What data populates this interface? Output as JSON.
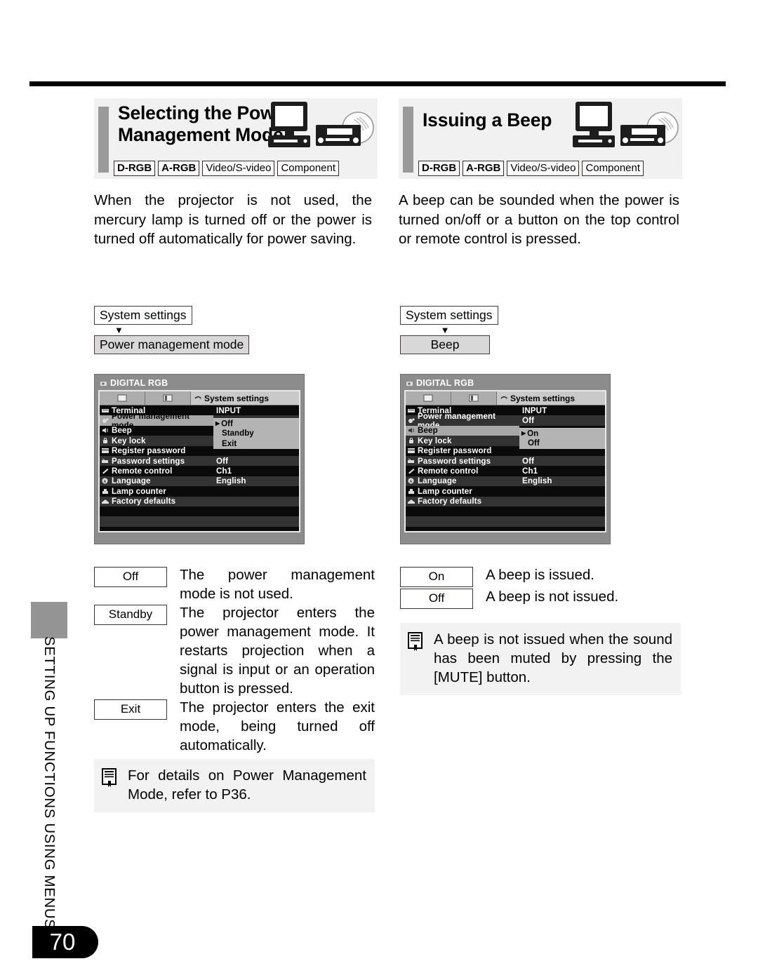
{
  "page": {
    "number": "70",
    "side_tab_label": "SETTING UP FUNCTIONS USING MENUS"
  },
  "sections": [
    {
      "title_line1": "Selecting the Power",
      "title_line2": "Management Mode",
      "badges": [
        "D-RGB",
        "A-RGB",
        "Video/S-video",
        "Component"
      ],
      "intro": "When the projector is not used, the mercury lamp is turned off or the power is turned off automatically for power saving.",
      "breadcrumb": {
        "parent": "System settings",
        "child": "Power management mode"
      },
      "osd": {
        "title": "DIGITAL RGB",
        "active_tab": "System settings",
        "rows": [
          {
            "label": "Terminal",
            "value": "INPUT",
            "icon": "terminal-icon"
          },
          {
            "label": "Power management mode",
            "value": "Off",
            "icon": "power-icon"
          },
          {
            "label": "Beep",
            "value": "",
            "icon": "beep-icon"
          },
          {
            "label": "Key lock",
            "value": "",
            "icon": "lock-icon"
          },
          {
            "label": "Register password",
            "value": "",
            "icon": "register-password-icon"
          },
          {
            "label": "Password settings",
            "value": "Off",
            "icon": "password-settings-icon"
          },
          {
            "label": "Remote control",
            "value": "Ch1",
            "icon": "remote-control-icon"
          },
          {
            "label": "Language",
            "value": "English",
            "icon": "language-icon"
          },
          {
            "label": "Lamp counter",
            "value": "",
            "icon": "lamp-counter-icon"
          },
          {
            "label": "Factory defaults",
            "value": "",
            "icon": "factory-defaults-icon"
          }
        ],
        "submenu": {
          "selected": "Off",
          "options": [
            "Off",
            "Standby",
            "Exit"
          ]
        }
      },
      "options": [
        {
          "key": "Off",
          "desc": "The power management mode is not used."
        },
        {
          "key": "Standby",
          "desc": "The projector enters the power management mode. It restarts projection when a signal is input or an operation button is pressed."
        },
        {
          "key": "Exit",
          "desc": "The projector enters the exit mode, being turned off automatically."
        }
      ],
      "note": "For details on Power Management Mode, refer to P36."
    },
    {
      "title_line1": "Issuing a Beep",
      "title_line2": "",
      "badges": [
        "D-RGB",
        "A-RGB",
        "Video/S-video",
        "Component"
      ],
      "intro": "A beep can be sounded when the power is turned on/off or a button on the top control or remote control is pressed.",
      "breadcrumb": {
        "parent": "System settings",
        "child": "Beep"
      },
      "osd": {
        "title": "DIGITAL RGB",
        "active_tab": "System settings",
        "rows": [
          {
            "label": "Terminal",
            "value": "INPUT",
            "icon": "terminal-icon"
          },
          {
            "label": "Power management mode",
            "value": "Off",
            "icon": "power-icon"
          },
          {
            "label": "Beep",
            "value": "",
            "icon": "beep-icon"
          },
          {
            "label": "Key lock",
            "value": "Off",
            "icon": "lock-icon"
          },
          {
            "label": "Register password",
            "value": "",
            "icon": "register-password-icon"
          },
          {
            "label": "Password settings",
            "value": "Off",
            "icon": "password-settings-icon"
          },
          {
            "label": "Remote control",
            "value": "Ch1",
            "icon": "remote-control-icon"
          },
          {
            "label": "Language",
            "value": "English",
            "icon": "language-icon"
          },
          {
            "label": "Lamp counter",
            "value": "",
            "icon": "lamp-counter-icon"
          },
          {
            "label": "Factory defaults",
            "value": "",
            "icon": "factory-defaults-icon"
          }
        ],
        "submenu": {
          "selected": "On",
          "options": [
            "On",
            "Off"
          ]
        }
      },
      "options": [
        {
          "key": "On",
          "desc": "A beep is issued."
        },
        {
          "key": "Off",
          "desc": "A beep is not issued."
        }
      ],
      "note": "A beep is not issued when the sound has been muted by pressing the [MUTE] button."
    }
  ]
}
